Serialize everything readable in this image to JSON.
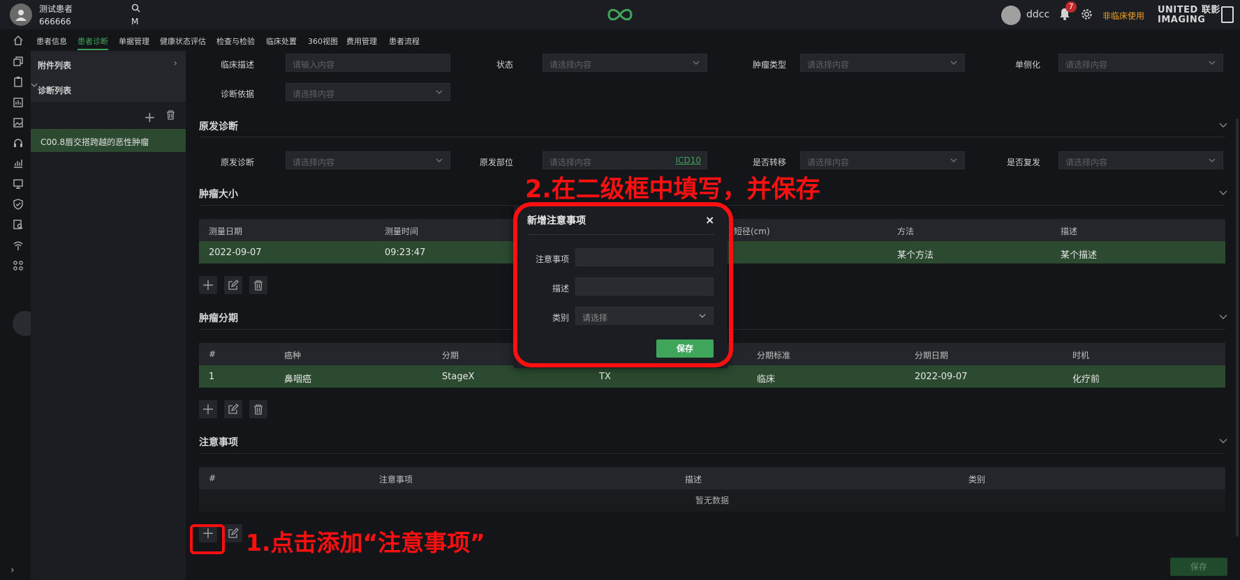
{
  "topbar": {
    "patient_name": "测试患者",
    "patient_id": "666666",
    "patient_sex": "M",
    "user_name": "ddcc",
    "notification_count": "7",
    "non_clinical_label": "非临床使用",
    "brand_line1": "UNITED 联影",
    "brand_line2": "IMAGING"
  },
  "nav": {
    "items": [
      "患者信息",
      "患者诊断",
      "单据管理",
      "健康状态评估",
      "检查与检验",
      "临床处置",
      "360视图",
      "费用管理",
      "患者流程"
    ],
    "active": "患者诊断",
    "accent": "#3fa55a"
  },
  "sidebar": {
    "attachments_label": "附件列表",
    "diagnosis_list_label": "诊断列表",
    "diagnosis_item": "C00.8唇交搭跨越的恶性肿瘤"
  },
  "form": {
    "clinical_desc_label": "临床描述",
    "clinical_desc_placeholder": "请输入内容",
    "status_label": "状态",
    "tumor_type_label": "肿瘤类型",
    "laterality_label": "单侧化",
    "diag_basis_label": "诊断依据",
    "select_placeholder": "请选择内容"
  },
  "primary": {
    "title": "原发诊断",
    "primary_diag_label": "原发诊断",
    "primary_site_label": "原发部位",
    "icd_link": "ICD10",
    "metastasis_label": "是否转移",
    "recurrence_label": "是否复发"
  },
  "tumor_size": {
    "title": "肿瘤大小",
    "headers": [
      "测量日期",
      "测量时间",
      "短径(cm)",
      "方法",
      "描述"
    ],
    "row": [
      "2022-09-07",
      "09:23:47",
      "某个方法",
      "某个描述"
    ]
  },
  "staging": {
    "title": "肿瘤分期",
    "headers": [
      "#",
      "癌种",
      "分期",
      "分期标准",
      "分期日期",
      "时机"
    ],
    "row": [
      "1",
      "鼻咽癌",
      "StageX",
      "TX",
      "临床",
      "2022-09-07",
      "化疗前"
    ]
  },
  "notes": {
    "title": "注意事项",
    "headers": [
      "#",
      "注意事项",
      "描述",
      "类别"
    ],
    "empty_text": "暂无数据"
  },
  "save_label": "保存",
  "modal": {
    "title": "新增注意事项",
    "close": "×",
    "note_label": "注意事项",
    "desc_label": "描述",
    "category_label": "类别",
    "category_placeholder": "请选择",
    "save_label": "保存"
  },
  "annotations": {
    "step1": "1.点击添加“注意事项”",
    "step2": "2.在二级框中填写，并保存",
    "color": "#ff1010"
  }
}
